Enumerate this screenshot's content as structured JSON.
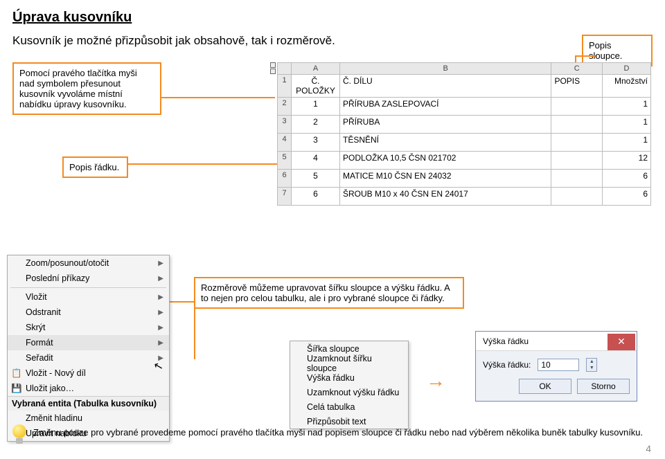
{
  "title": "Úprava kusovníku",
  "subtitle": "Kusovník je možné přizpůsobit jak obsahově, tak i rozměrově.",
  "callouts": {
    "column": "Popis sloupce.",
    "context": "Pomocí pravého tlačítka myši nad symbolem přesunout kusovník vyvoláme místní nabídku úpravy kusovníku.",
    "row": "Popis řádku.",
    "size": "Rozměrově můžeme upravovat šířku sloupce a výšku řádku. A to nejen pro celou tabulku, ale i pro vybrané sloupce či řádky."
  },
  "bom": {
    "col_letters": [
      "A",
      "B",
      "C",
      "D"
    ],
    "headers": {
      "col1": "Č. POLOŽKY",
      "col2": "Č. DÍLU",
      "col3": "POPIS",
      "col4": "Množství"
    },
    "rows": [
      {
        "n": "1",
        "part": "PŘÍRUBA ZASLEPOVACÍ",
        "qty": "1"
      },
      {
        "n": "2",
        "part": "PŘÍRUBA",
        "qty": "1"
      },
      {
        "n": "3",
        "part": "TĚSNĚNÍ",
        "qty": "1"
      },
      {
        "n": "4",
        "part": "PODLOŽKA 10,5 ČSN 021702",
        "qty": "12"
      },
      {
        "n": "5",
        "part": "MATICE M10 ČSN EN 24032",
        "qty": "6"
      },
      {
        "n": "6",
        "part": "ŠROUB M10 x 40 ČSN EN 24017",
        "qty": "6"
      }
    ],
    "row_nums": [
      "1",
      "2",
      "3",
      "4",
      "5",
      "6",
      "7"
    ]
  },
  "context_menu": {
    "items": [
      {
        "label": "Zoom/posunout/otočit",
        "sub": true
      },
      {
        "label": "Poslední příkazy",
        "sub": true,
        "sep_after": true
      },
      {
        "label": "Vložit",
        "sub": true
      },
      {
        "label": "Odstranit",
        "sub": true
      },
      {
        "label": "Skrýt",
        "sub": true
      },
      {
        "label": "Formát",
        "sub": true,
        "hover": true
      },
      {
        "label": "Seřadit",
        "sub": true
      },
      {
        "label": "Vložit - Nový díl",
        "icon": "📋"
      },
      {
        "label": "Uložit jako…",
        "icon": "💾",
        "sep_after": true
      }
    ],
    "entity_title": "Vybraná entita (Tabulka kusovníku)",
    "entity_items": [
      {
        "label": "Změnit hladinu"
      },
      {
        "label": "Upravit nabídku"
      }
    ]
  },
  "submenu": {
    "items": [
      "Šířka sloupce",
      "Uzamknout šířku sloupce",
      "Výška řádku",
      "Uzamknout výšku řádku",
      "Celá tabulka",
      "Přizpůsobit text"
    ]
  },
  "dialog": {
    "title": "Výška řádku",
    "label": "Výška řádku:",
    "value": "10",
    "ok": "OK",
    "cancel": "Storno"
  },
  "tip": "Změnu pouze pro vybrané provedeme pomocí pravého tlačítka myši nad popisem sloupce či řádku nebo nad výběrem několika buněk tabulky kusovníku.",
  "page": "4"
}
